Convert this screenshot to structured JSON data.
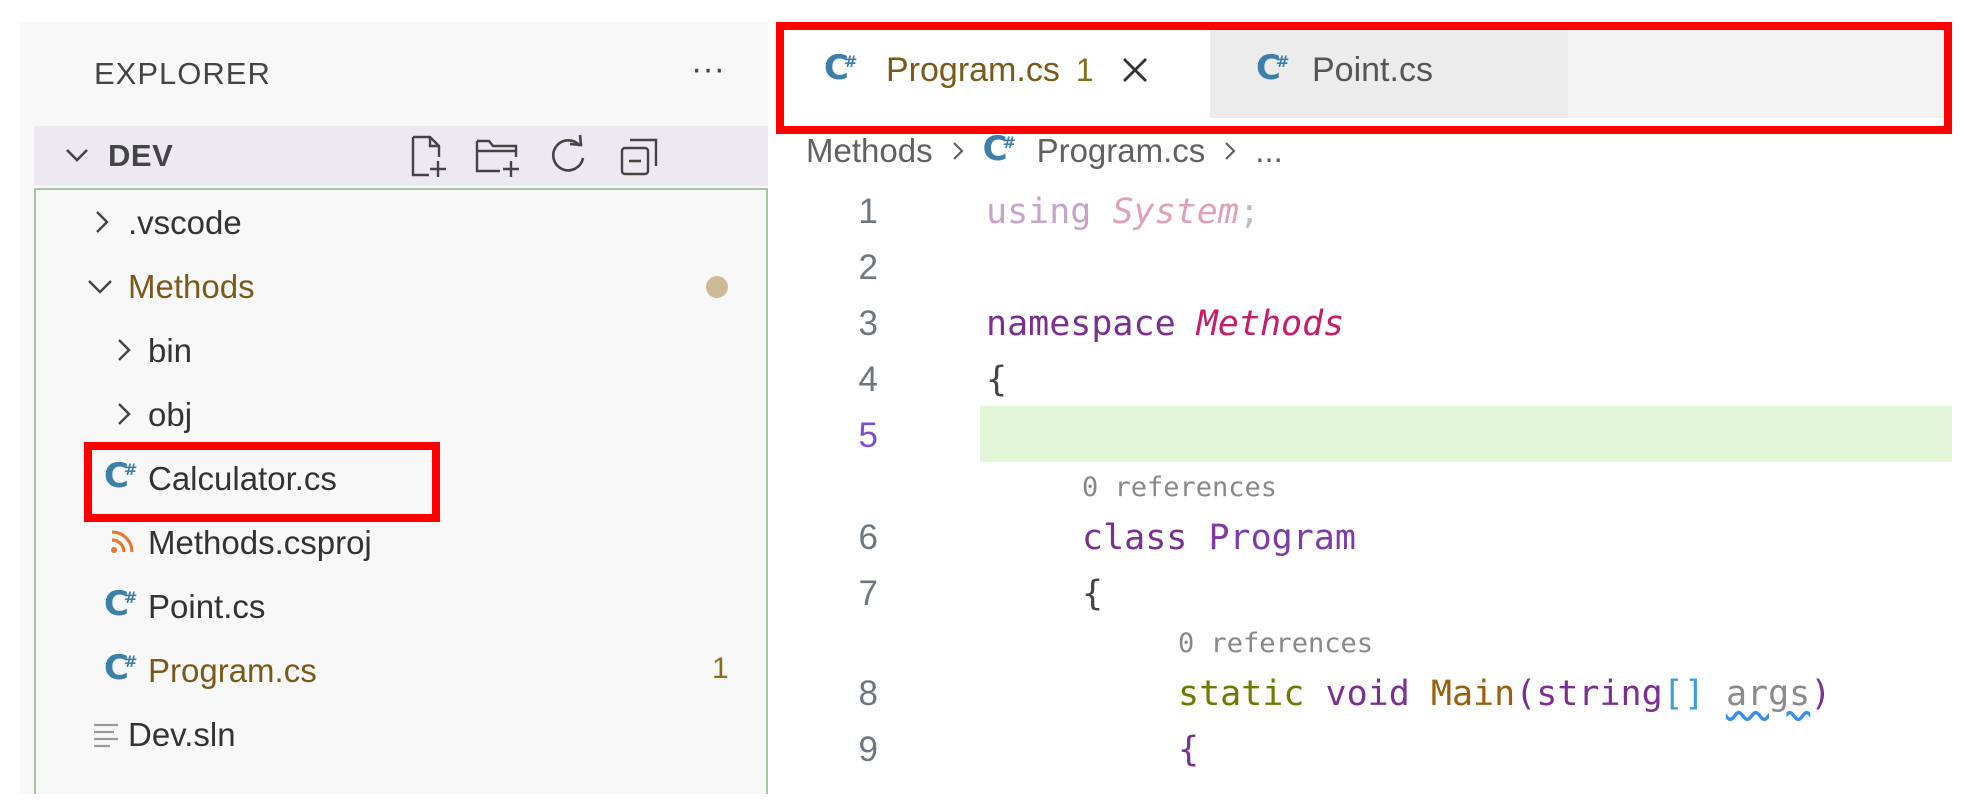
{
  "sidebar": {
    "title": "EXPLORER",
    "more_label": "···",
    "section": {
      "title": "DEV",
      "actions": [
        "new-file-icon",
        "new-folder-icon",
        "refresh-icon",
        "collapse-all-icon"
      ]
    },
    "tree": [
      {
        "label": ".vscode",
        "kind": "folder",
        "expanded": false,
        "depth": 0
      },
      {
        "label": "Methods",
        "kind": "folder",
        "expanded": true,
        "depth": 0,
        "modified": true
      },
      {
        "label": "bin",
        "kind": "folder",
        "expanded": false,
        "depth": 1
      },
      {
        "label": "obj",
        "kind": "folder",
        "expanded": false,
        "depth": 1
      },
      {
        "label": "Calculator.cs",
        "kind": "csharp",
        "depth": 1
      },
      {
        "label": "Methods.csproj",
        "kind": "rss",
        "depth": 1
      },
      {
        "label": "Point.cs",
        "kind": "csharp",
        "depth": 1
      },
      {
        "label": "Program.cs",
        "kind": "csharp",
        "depth": 1,
        "modified": true,
        "badge": "1"
      },
      {
        "label": "Dev.sln",
        "kind": "lines",
        "depth": 0
      }
    ]
  },
  "tabs": [
    {
      "label": "Program.cs",
      "badge": "1",
      "active": true
    },
    {
      "label": "Point.cs",
      "active": false
    }
  ],
  "breadcrumb": {
    "folder": "Methods",
    "file": "Program.cs",
    "more": "..."
  },
  "code": {
    "lines": [
      {
        "n": "1",
        "tokens": [
          [
            "using",
            "kw-using"
          ],
          [
            " "
          ],
          [
            "System",
            "ty-sys"
          ],
          [
            ";",
            "punct"
          ]
        ]
      },
      {
        "n": "2",
        "tokens": []
      },
      {
        "n": "3",
        "tokens": [
          [
            "namespace",
            "kw"
          ],
          [
            " "
          ],
          [
            "Methods",
            "ns"
          ]
        ]
      },
      {
        "n": "4",
        "tokens": [
          [
            "{",
            "brace"
          ]
        ]
      },
      {
        "n": "5",
        "tokens": [],
        "current": true
      },
      {
        "lens": "0 references",
        "indent": 1
      },
      {
        "n": "6",
        "indent": 1,
        "tokens": [
          [
            "class",
            "kw"
          ],
          [
            " "
          ],
          [
            "Program",
            "cls"
          ]
        ]
      },
      {
        "n": "7",
        "indent": 1,
        "tokens": [
          [
            "{",
            "brace"
          ]
        ]
      },
      {
        "lens": "0 references",
        "indent": 2
      },
      {
        "n": "8",
        "indent": 2,
        "tokens": [
          [
            "static",
            "kw-static"
          ],
          [
            " "
          ],
          [
            "void",
            "kw"
          ],
          [
            " "
          ],
          [
            "Main",
            "fn"
          ],
          [
            "(",
            "pur"
          ],
          [
            "string",
            "kw"
          ],
          [
            "[]",
            "bracket"
          ],
          [
            " "
          ],
          [
            "args",
            "param"
          ],
          [
            ")",
            "pur"
          ]
        ]
      },
      {
        "n": "9",
        "indent": 2,
        "tokens": [
          [
            "{",
            "pur"
          ]
        ]
      }
    ]
  },
  "colors": {
    "highlight_box": "#ff0000",
    "modified_text": "#7a5a1b",
    "csharp_icon": "#3d7fa8",
    "current_line": "#e4f6d8"
  }
}
